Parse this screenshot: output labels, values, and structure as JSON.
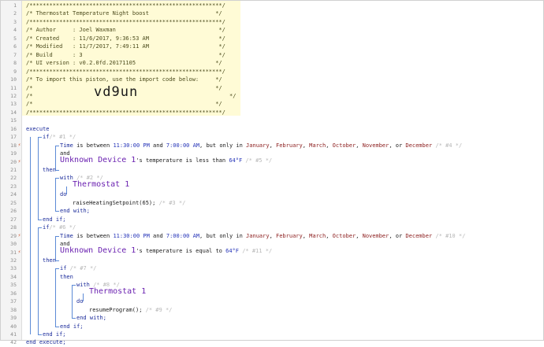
{
  "gutter": {
    "line_numbers": [
      "1",
      "2",
      "3",
      "4",
      "5",
      "6",
      "7",
      "8",
      "9",
      "10",
      "11",
      "12",
      "13",
      "14",
      "15",
      "16",
      "17",
      "18",
      "19",
      "20",
      "21",
      "22",
      "23",
      "24",
      "25",
      "26",
      "27",
      "28",
      "29",
      "30",
      "31",
      "32",
      "33",
      "34",
      "35",
      "36",
      "37",
      "38",
      "39",
      "40",
      "41",
      "42"
    ],
    "markers": [
      {
        "line": 18,
        "symbol": "⚡"
      },
      {
        "line": 20,
        "symbol": "⚡"
      },
      {
        "line": 29,
        "symbol": "⚡"
      },
      {
        "line": 31,
        "symbol": "⚡"
      }
    ]
  },
  "header_comment": {
    "border_top": "/**********************************************************/",
    "title": "/* Thermostat Temperature Night boost                    */",
    "border2": "/**********************************************************/",
    "author": "/* Author     : Joel Waxman                               */",
    "created": "/* Created    : 11/6/2017, 9:36:53 AM                     */",
    "modified": "/* Modified   : 11/7/2017, 7:49:11 AM                     */",
    "build": "/* Build      : 3                                         */",
    "ui_version": "/* UI version : v0.2.0fd.20171105                        */",
    "border3": "/**********************************************************/",
    "import_note": "/* To import this piston, use the import code below:     */",
    "blank1": "/*                                                       */",
    "code_line_open": "/*",
    "import_code": "vd9un",
    "code_line_close": "*/",
    "blank2": "/*                                                       */",
    "border4": "/**********************************************************/"
  },
  "code": {
    "execute": "execute",
    "if1": {
      "if_kw": "if",
      "if_comment": "/* #1 */",
      "cond1_a": "Time",
      "cond1_b": " is between ",
      "cond1_t1": "11:30:00 PM",
      "cond1_c": " and ",
      "cond1_t2": "7:00:00 AM",
      "cond1_d": ", but only in ",
      "months": [
        "January",
        "February",
        "March",
        "October",
        "November"
      ],
      "or_text": ", or ",
      "month_last": "December",
      "cond1_comment": "/* #4 */",
      "and_kw": "and",
      "device": "Unknown Device 1",
      "cond2_text": "'s temperature is less than ",
      "cond2_value": "64°F",
      "cond2_comment": "/* #5 */",
      "then_kw": "then",
      "with_kw": "with",
      "with_comment": "/* #2 */",
      "with_device": "Thermostat 1",
      "do_kw": "do",
      "action": "raiseHeatingSetpoint(65);",
      "action_comment": "/* #3 */",
      "end_with": "end with;",
      "end_if": "end if;"
    },
    "if2": {
      "if_kw": "if",
      "if_comment": "/* #6 */",
      "cond1_a": "Time",
      "cond1_b": " is between ",
      "cond1_t1": "11:30:00 PM",
      "cond1_c": " and ",
      "cond1_t2": "7:00:00 AM",
      "cond1_d": ", but only in ",
      "months": [
        "January",
        "February",
        "March",
        "October",
        "November"
      ],
      "or_text": ", or ",
      "month_last": "December",
      "cond1_comment": "/* #10 */",
      "and_kw": "and",
      "device": "Unknown Device 1",
      "cond2_text": "'s temperature is equal to ",
      "cond2_value": "64°F",
      "cond2_comment": "/* #11 */",
      "then_kw": "then",
      "inner_if_kw": "if",
      "inner_if_comment": "/* #7 */",
      "inner_then_kw": "then",
      "with_kw": "with",
      "with_comment": "/* #8 */",
      "with_device": "Thermostat 1",
      "do_kw": "do",
      "action": "resumeProgram();",
      "action_comment": "/* #9 */",
      "end_with": "end with;",
      "inner_end_if": "end if;",
      "end_if": "end if;"
    },
    "end_execute": "end execute;"
  }
}
